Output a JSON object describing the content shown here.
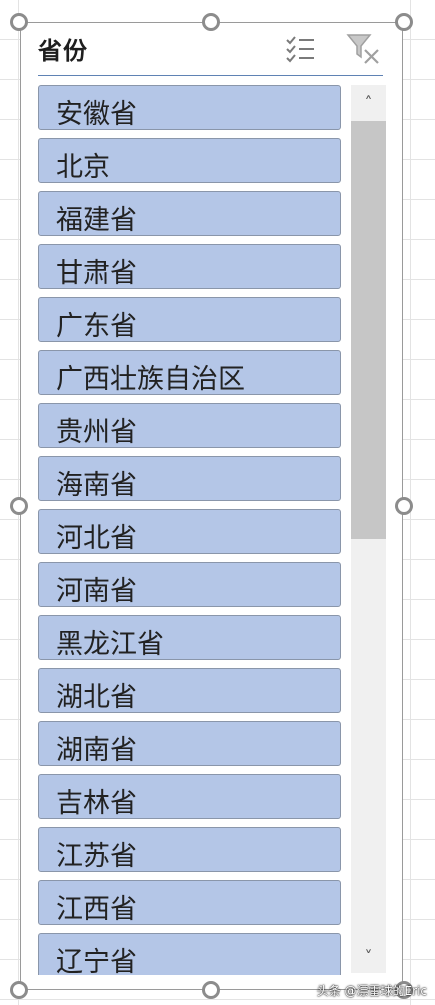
{
  "slicer": {
    "title": "省份",
    "multi_select_icon": "multi-select-icon",
    "clear_filter_icon": "clear-filter-icon",
    "accent_color": "#b4c6e7",
    "items": [
      {
        "label": "安徽省"
      },
      {
        "label": "北京"
      },
      {
        "label": "福建省"
      },
      {
        "label": "甘肃省"
      },
      {
        "label": "广东省"
      },
      {
        "label": "广西壮族自治区"
      },
      {
        "label": "贵州省"
      },
      {
        "label": "海南省"
      },
      {
        "label": "河北省"
      },
      {
        "label": "河南省"
      },
      {
        "label": "黑龙江省"
      },
      {
        "label": "湖北省"
      },
      {
        "label": "湖南省"
      },
      {
        "label": "吉林省"
      },
      {
        "label": "江苏省"
      },
      {
        "label": "江西省"
      },
      {
        "label": "辽宁省"
      }
    ],
    "scroll_up": "˄",
    "scroll_down": "˅"
  },
  "watermark": "头条 @漂雷球的Eric"
}
